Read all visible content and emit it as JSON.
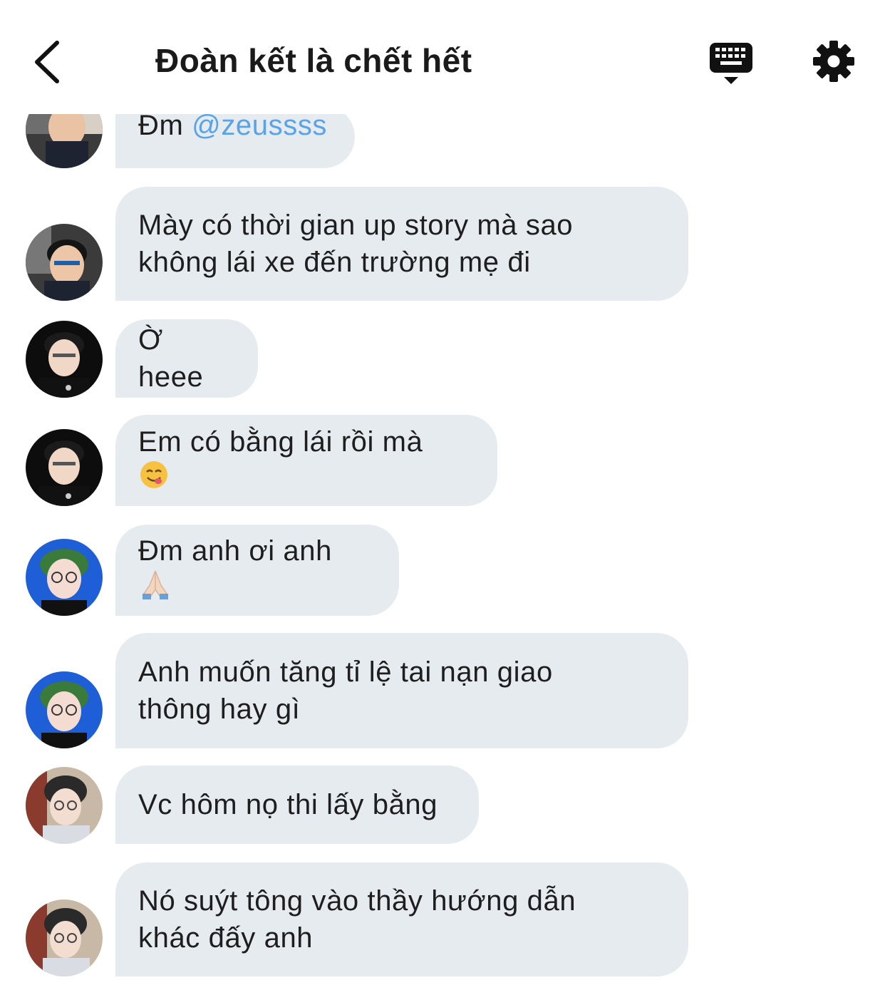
{
  "header": {
    "title": "Đoàn kết là chết hết"
  },
  "icons": {
    "back": "chevron-left-icon",
    "keyboard": "keyboard-icon",
    "settings": "gear-icon"
  },
  "colors": {
    "bubble": "#e6ebf0",
    "mention": "#5aa3e6",
    "text": "#1e1e1e"
  },
  "messages": [
    {
      "prefix": "Đm ",
      "mention": "@zeussss"
    },
    {
      "text": "Mày có thời gian up story mà sao không lái xe đến trường mẹ đi"
    },
    {
      "text": "Ờ heee"
    },
    {
      "text": "Em có bằng lái rồi mà",
      "emoji": "yum-face"
    },
    {
      "text": "Đm anh ơi anh",
      "emoji": "folded-hands"
    },
    {
      "text": "Anh muốn tăng tỉ lệ tai nạn giao thông hay gì"
    },
    {
      "text": "Vc hôm nọ thi lấy bằng"
    },
    {
      "text": "Nó suýt tông vào thầy hướng dẫn khác đấy anh"
    }
  ]
}
